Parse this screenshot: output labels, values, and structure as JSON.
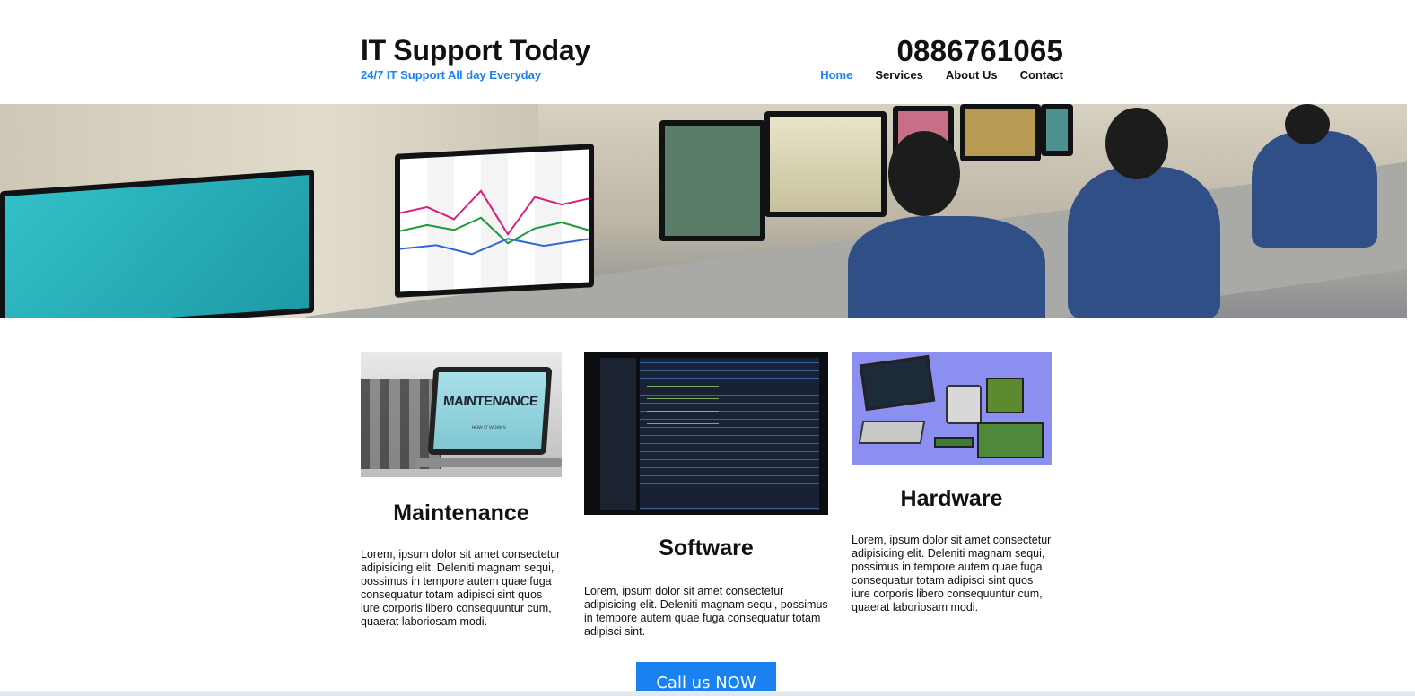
{
  "header": {
    "title": "IT Support Today",
    "tagline": "24/7 IT Support All day Everyday",
    "phone": "0886761065"
  },
  "nav": {
    "items": [
      {
        "label": "Home",
        "active": true
      },
      {
        "label": "Services",
        "active": false
      },
      {
        "label": "About Us",
        "active": false
      },
      {
        "label": "Contact",
        "active": false
      }
    ]
  },
  "hero": {
    "image_subject": "control-room-operators-photo"
  },
  "cards": [
    {
      "title": "Maintenance",
      "image_subject": "maintenance-laptop-photo",
      "image_text": "MAINTENANCE",
      "image_subtext": "HOW IT WORKS",
      "text": "Lorem, ipsum dolor sit amet consectetur adipisicing elit. Deleniti magnam sequi, possimus in tempore autem quae fuga consequatur totam adipisci sint quos iure corporis libero consequuntur cum, quaerat laboriosam modi."
    },
    {
      "title": "Software",
      "image_subject": "code-editor-laptop-photo",
      "text": "Lorem, ipsum dolor sit amet consectetur adipisicing elit. Deleniti magnam sequi, possimus in tempore autem quae fuga consequatur totam adipisci sint."
    },
    {
      "title": "Hardware",
      "image_subject": "computer-hardware-illustration",
      "text": "Lorem, ipsum dolor sit amet consectetur adipisicing elit. Deleniti magnam sequi, possimus in tempore autem quae fuga consequatur totam adipisci sint quos iure corporis libero consequuntur cum, quaerat laboriosam modi."
    }
  ],
  "cta": {
    "label": "Call us NOW"
  },
  "colors": {
    "accent": "#1a82f0",
    "text": "#111111",
    "background": "#ffffff"
  }
}
